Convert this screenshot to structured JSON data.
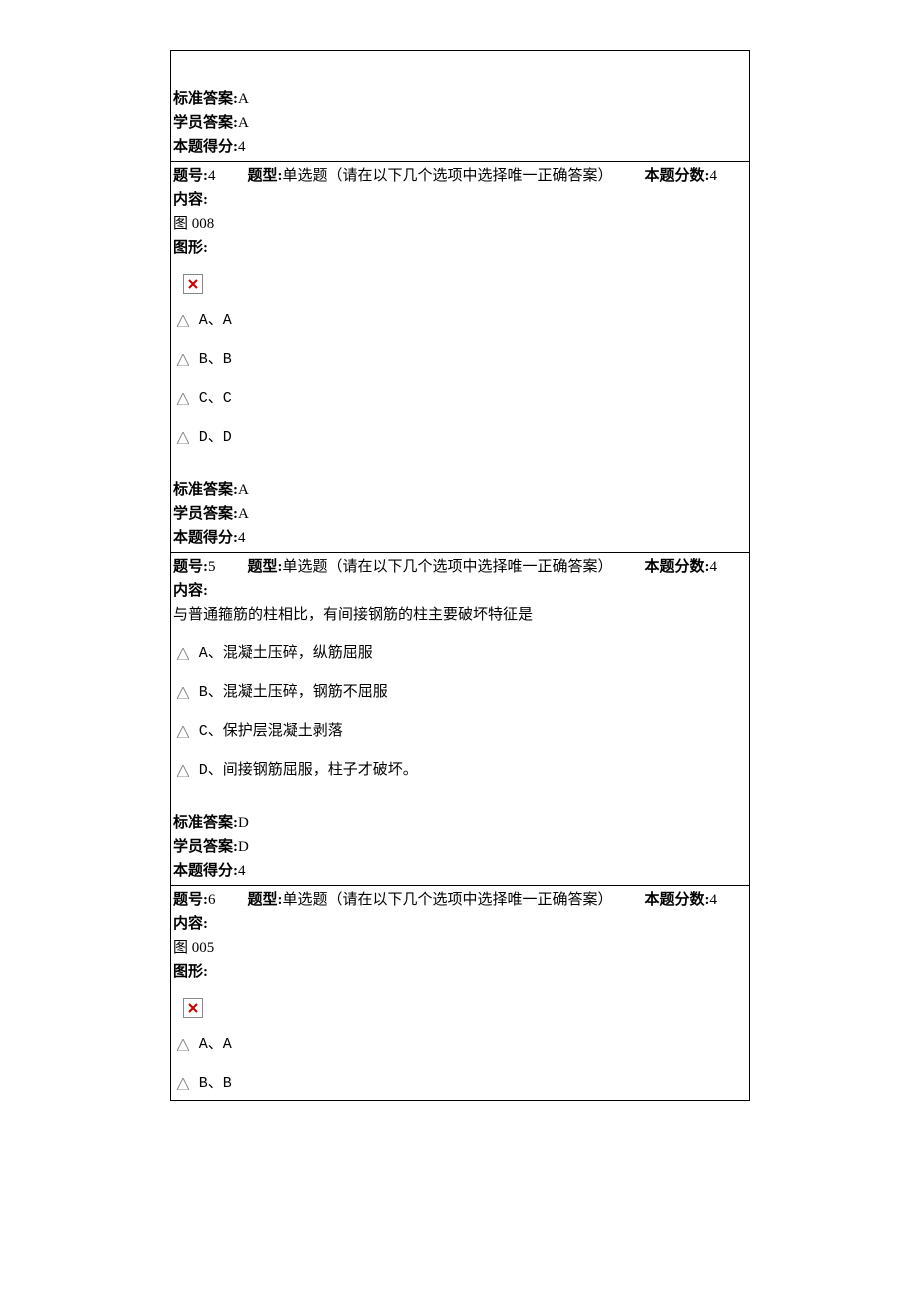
{
  "labels": {
    "standard_answer": "标准答案:",
    "student_answer": "学员答案:",
    "score_earned": "本题得分:",
    "question_no": "题号:",
    "question_type": "题型:",
    "question_type_text": "单选题（请在以下几个选项中选择唯一正确答案）",
    "full_score": "本题分数:",
    "content": "内容:",
    "figure": "图形:"
  },
  "prev_question": {
    "standard_answer": "A",
    "student_answer": "A",
    "score_earned": "4"
  },
  "q4": {
    "number": "4",
    "full_score": "4",
    "image_ref": "图 008",
    "options": {
      "a": "A、A",
      "b": "B、B",
      "c": "C、C",
      "d": "D、D"
    },
    "standard_answer": "A",
    "student_answer": "A",
    "score_earned": "4"
  },
  "q5": {
    "number": "5",
    "full_score": "4",
    "stem": "与普通箍筋的柱相比，有间接钢筋的柱主要破坏特征是",
    "options": {
      "a": "A、混凝土压碎，纵筋屈服",
      "b": "B、混凝土压碎，钢筋不屈服",
      "c": "C、保护层混凝土剥落",
      "d": "D、间接钢筋屈服，柱子才破坏。"
    },
    "standard_answer": "D",
    "student_answer": "D",
    "score_earned": "4"
  },
  "q6": {
    "number": "6",
    "full_score": "4",
    "image_ref": "图 005",
    "options": {
      "a": "A、A",
      "b": "B、B"
    }
  }
}
